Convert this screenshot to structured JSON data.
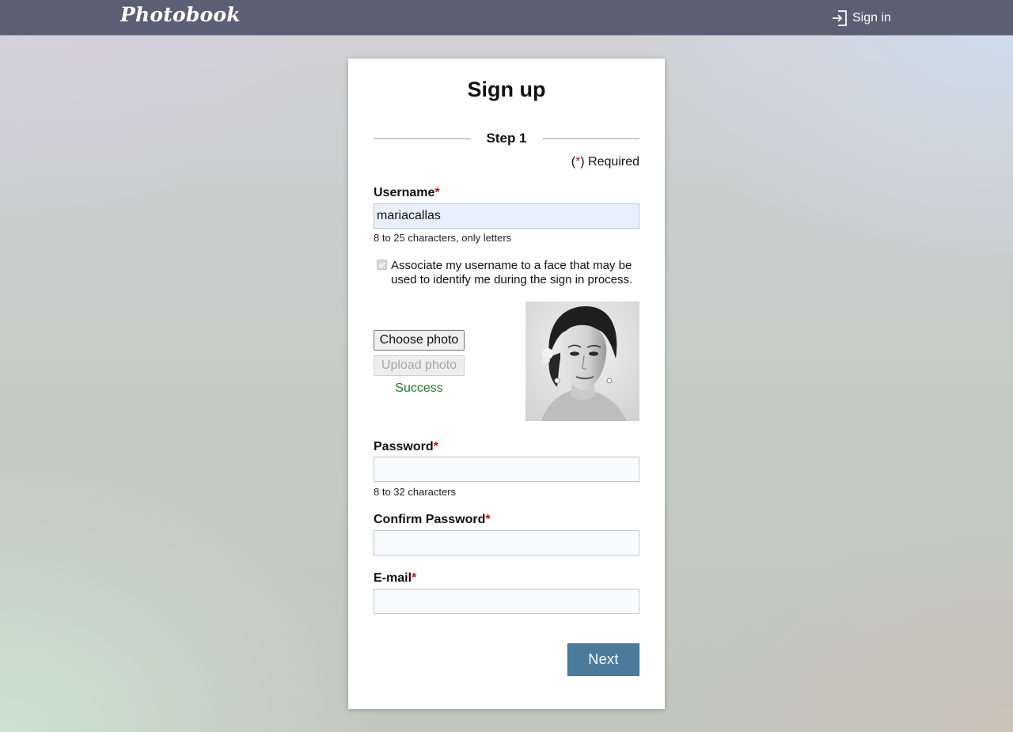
{
  "header": {
    "logo": "Photobook",
    "signin_label": "Sign in",
    "background_color": "#5a5f73"
  },
  "form": {
    "title": "Sign up",
    "step_label": "Step 1",
    "required_prefix": "(",
    "required_star": "*",
    "required_suffix": ") Required",
    "username": {
      "label": "Username",
      "value": "mariacallas",
      "hint": "8 to 25 characters, only letters"
    },
    "face_checkbox": {
      "checked": true,
      "label": "Associate my username to a face that may be used to identify me during the sign in process."
    },
    "photo": {
      "choose_label": "Choose photo",
      "upload_label": "Upload photo",
      "status": "Success"
    },
    "password": {
      "label": "Password",
      "value": "",
      "hint": "8 to 32 characters"
    },
    "confirm_password": {
      "label": "Confirm Password",
      "value": ""
    },
    "email": {
      "label": "E-mail",
      "value": ""
    },
    "next_label": "Next"
  },
  "colors": {
    "accent": "#4a7b9b",
    "required_star": "#d01010",
    "success": "#1e7a1e"
  }
}
